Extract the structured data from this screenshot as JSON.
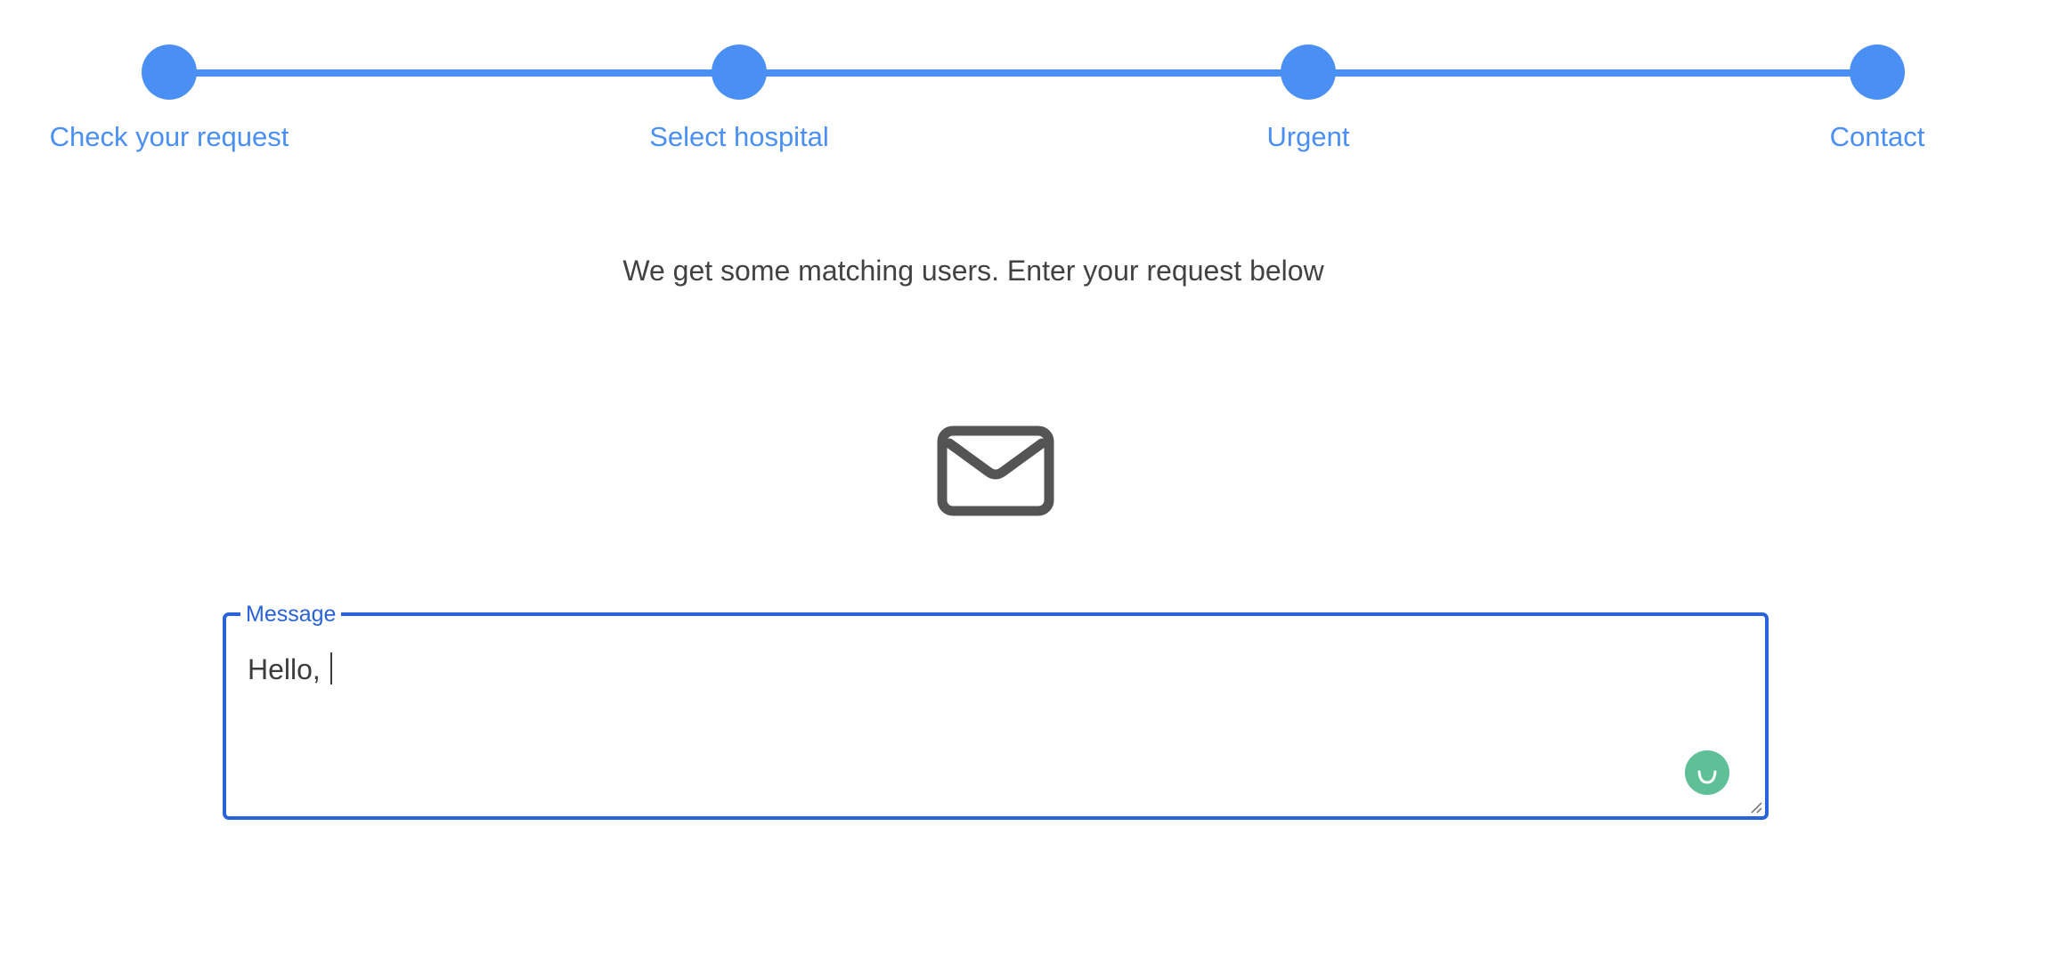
{
  "colors": {
    "accent": "#4a8ff3",
    "field_border": "#2962d9",
    "text": "#424242",
    "icon": "#545454",
    "assistant": "#5fbf97"
  },
  "stepper": {
    "steps": [
      {
        "label": "Check your request"
      },
      {
        "label": "Select hospital"
      },
      {
        "label": "Urgent"
      },
      {
        "label": "Contact"
      }
    ]
  },
  "instruction": "We get some matching users. Enter your request below",
  "message": {
    "label": "Message",
    "value": "Hello, "
  },
  "icons": {
    "mail": "envelope-icon",
    "assistant": "grammar-assistant-icon",
    "resize": "resize-handle-icon"
  }
}
